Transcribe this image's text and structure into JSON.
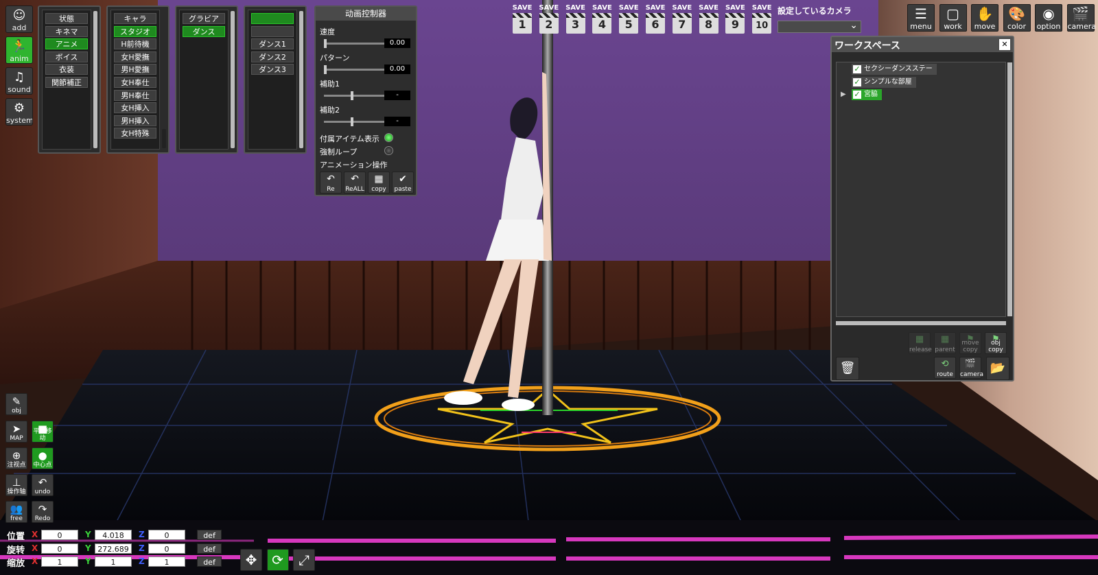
{
  "left_toolbar": [
    {
      "label": "add",
      "glyph": "☺",
      "icon": "person-add-icon",
      "active": false
    },
    {
      "label": "anim",
      "glyph": "🏃",
      "icon": "running-figure-icon",
      "active": true
    },
    {
      "label": "sound",
      "glyph": "♫",
      "icon": "music-note-icon",
      "active": false
    },
    {
      "label": "system",
      "glyph": "⚙",
      "icon": "gear-icon",
      "active": false
    }
  ],
  "anim_lists": {
    "col1": [
      {
        "label": "状態",
        "sel": false
      },
      {
        "label": "キネマ",
        "sel": false
      },
      {
        "label": "アニメ",
        "sel": true
      },
      {
        "label": "ボイス",
        "sel": false
      },
      {
        "label": "衣装",
        "sel": false
      },
      {
        "label": "関節補正",
        "sel": false
      }
    ],
    "col2": [
      {
        "label": "キャラ",
        "sel": false
      },
      {
        "label": "スタジオ",
        "sel": true
      },
      {
        "label": "H前待機",
        "sel": false
      },
      {
        "label": "女H愛撫",
        "sel": false
      },
      {
        "label": "男H愛撫",
        "sel": false
      },
      {
        "label": "女H奉仕",
        "sel": false
      },
      {
        "label": "男H奉仕",
        "sel": false
      },
      {
        "label": "女H挿入",
        "sel": false
      },
      {
        "label": "男H挿入",
        "sel": false
      },
      {
        "label": "女H特殊",
        "sel": false
      }
    ],
    "col3": [
      {
        "label": "グラビア",
        "sel": false
      },
      {
        "label": "ダンス",
        "sel": true
      }
    ],
    "col4": [
      {
        "label": "",
        "sel": true
      },
      {
        "label": "",
        "sel": false
      },
      {
        "label": "ダンス1",
        "sel": false
      },
      {
        "label": "ダンス2",
        "sel": false
      },
      {
        "label": "ダンス3",
        "sel": false
      }
    ]
  },
  "video_controller": {
    "title": "动画控制器",
    "speed_label": "速度",
    "speed_value": "0.00",
    "speed_level": 0,
    "pattern_label": "パターン",
    "pattern_value": "0.00",
    "pattern_level": 0,
    "aux1_label": "補助1",
    "aux1_value": "-",
    "aux1_level": 0.45,
    "aux2_label": "補助2",
    "aux2_value": "-",
    "aux2_level": 0.45,
    "accessory_label": "付属アイテム表示",
    "accessory_on": true,
    "loop_label": "強制ループ",
    "loop_on": false,
    "anim_ops_label": "アニメーション操作",
    "ops": [
      {
        "label": "Re",
        "glyph": "↶",
        "icon": "undo-arrow-icon"
      },
      {
        "label": "ReALL",
        "glyph": "↶",
        "icon": "undo-all-arrow-icon"
      },
      {
        "label": "copy",
        "glyph": "▦",
        "icon": "copy-icon"
      },
      {
        "label": "paste",
        "glyph": "✔",
        "icon": "paste-check-icon"
      }
    ]
  },
  "save_slots": [
    {
      "label": "SAVE",
      "num": "1"
    },
    {
      "label": "SAVE",
      "num": "2"
    },
    {
      "label": "SAVE",
      "num": "3"
    },
    {
      "label": "SAVE",
      "num": "4"
    },
    {
      "label": "SAVE",
      "num": "5"
    },
    {
      "label": "SAVE",
      "num": "6"
    },
    {
      "label": "SAVE",
      "num": "7"
    },
    {
      "label": "SAVE",
      "num": "8"
    },
    {
      "label": "SAVE",
      "num": "9"
    },
    {
      "label": "SAVE",
      "num": "10"
    }
  ],
  "camera_select": {
    "label": "設定しているカメラ",
    "value": ""
  },
  "top_right": [
    {
      "label": "menu",
      "glyph": "☰",
      "icon": "menu-list-icon"
    },
    {
      "label": "work",
      "glyph": "▢",
      "icon": "work-frame-icon"
    },
    {
      "label": "move",
      "glyph": "✋",
      "icon": "hand-move-icon"
    },
    {
      "label": "color",
      "glyph": "🎨",
      "icon": "palette-icon"
    },
    {
      "label": "option",
      "glyph": "◉",
      "icon": "eye-option-icon"
    },
    {
      "label": "camera",
      "glyph": "🎬",
      "icon": "clapper-camera-icon"
    }
  ],
  "workspace": {
    "title": "ワークスペース",
    "close_glyph": "✕",
    "items": [
      {
        "label": "セクシーダンスステー",
        "checked": true,
        "sel": false
      },
      {
        "label": "シンプルな部屋",
        "checked": true,
        "sel": false
      },
      {
        "label": "宮脇",
        "checked": true,
        "sel": true
      }
    ],
    "check_glyph": "✓",
    "expand_glyph": "▶",
    "tools": [
      {
        "label": "release",
        "glyph": "▦",
        "icon": "release-icon",
        "disabled": true
      },
      {
        "label": "parent",
        "glyph": "▦",
        "icon": "parent-icon",
        "disabled": true
      },
      {
        "label": "move copy",
        "glyph": "⚑",
        "icon": "move-copy-icon",
        "disabled": true
      },
      {
        "label": "obj copy",
        "glyph": "⚑",
        "icon": "obj-copy-icon",
        "disabled": false
      },
      {
        "label": "route",
        "glyph": "⟲",
        "icon": "route-icon",
        "disabled": false
      },
      {
        "label": "camera",
        "glyph": "🎬",
        "icon": "camera-clapper-icon",
        "disabled": false
      }
    ],
    "delete_glyph": "🗑",
    "folder_glyph": "📂"
  },
  "bottom_left_buttons": [
    {
      "label": "obj",
      "glyph": "✎",
      "icon": "obj-edit-icon",
      "green": false
    },
    {
      "label": "MAP",
      "glyph": "➤",
      "icon": "map-pointer-icon",
      "green": false
    },
    {
      "label": "平行移动",
      "glyph": "■",
      "icon": "parallel-move-icon",
      "green": true
    },
    {
      "label": "注视点",
      "glyph": "⊕",
      "icon": "gaze-point-icon",
      "green": false
    },
    {
      "label": "中心点",
      "glyph": "●",
      "icon": "center-point-icon",
      "green": true
    },
    {
      "label": "操作轴",
      "glyph": "⊥",
      "icon": "axis-icon",
      "green": false
    },
    {
      "label": "undo",
      "glyph": "↶",
      "icon": "undo-icon",
      "green": false
    },
    {
      "label": "free",
      "glyph": "👥",
      "icon": "free-camera-icon",
      "green": false
    },
    {
      "label": "Redo",
      "glyph": "↷",
      "icon": "redo-icon",
      "green": false
    }
  ],
  "transform": {
    "rows": [
      {
        "label": "位置",
        "x": "0",
        "y": "4.018",
        "z": "0",
        "def": "def"
      },
      {
        "label": "旋转",
        "x": "0",
        "y": "272.689",
        "z": "0",
        "def": "def"
      },
      {
        "label": "缩放",
        "x": "1",
        "y": "1",
        "z": "1",
        "def": "def"
      }
    ],
    "axes": {
      "x": "X",
      "y": "Y",
      "z": "Z"
    },
    "gizmo": [
      {
        "glyph": "✥",
        "icon": "move-gizmo-icon",
        "active": false
      },
      {
        "glyph": "⟳",
        "icon": "rotate-gizmo-icon",
        "active": true
      },
      {
        "glyph": "⤢",
        "icon": "scale-gizmo-icon",
        "active": false
      }
    ]
  },
  "colors": {
    "accent_green": "#2fb42f",
    "panel_bg": "#2b2b2b",
    "wall": "#5e3c80",
    "neon_pink": "#e23bc8"
  }
}
